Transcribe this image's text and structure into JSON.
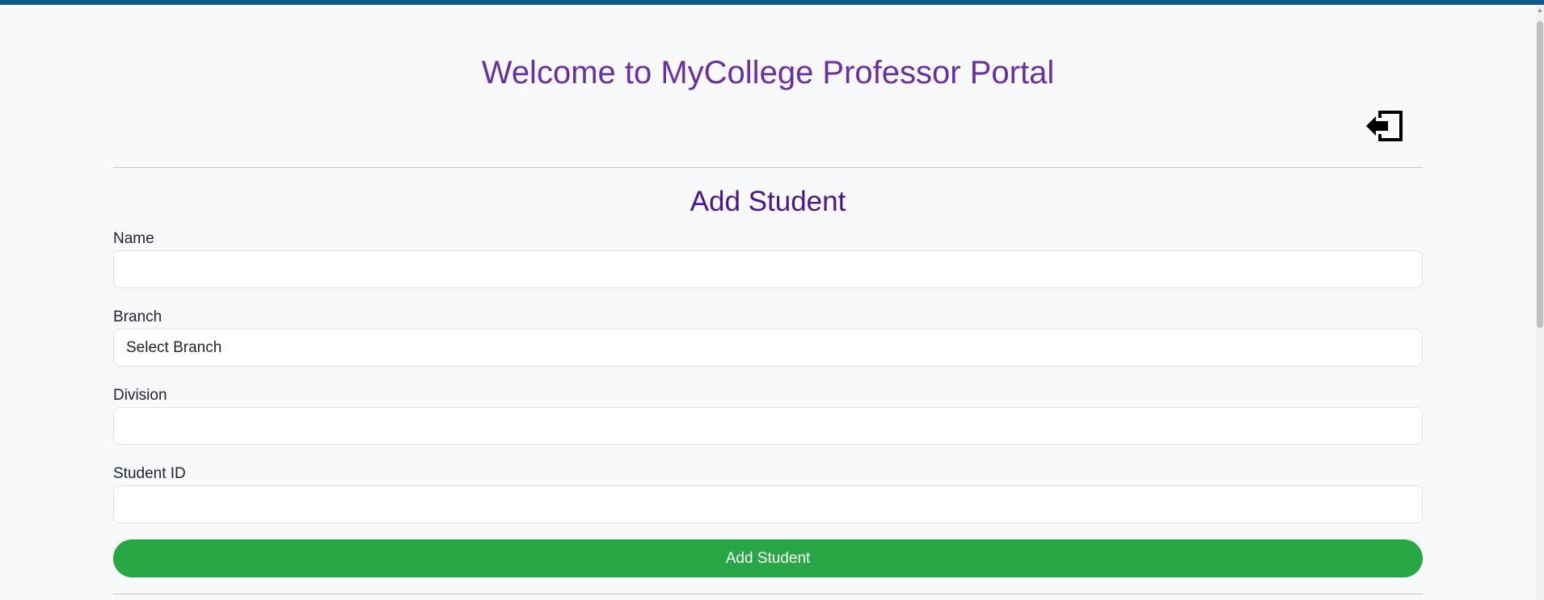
{
  "header": {
    "title": "Welcome to MyCollege Professor Portal",
    "logout_icon": "logout-arrow-icon",
    "bar_color": "#0e5a8a"
  },
  "form": {
    "title": "Add Student",
    "fields": {
      "name": {
        "label": "Name",
        "value": ""
      },
      "branch": {
        "label": "Branch",
        "selected": "Select Branch"
      },
      "division": {
        "label": "Division",
        "value": ""
      },
      "student_id": {
        "label": "Student ID",
        "value": ""
      }
    },
    "submit_label": "Add Student"
  },
  "colors": {
    "title": "#6a2fa0",
    "form_title": "#4b1689",
    "submit": "#28a745"
  }
}
